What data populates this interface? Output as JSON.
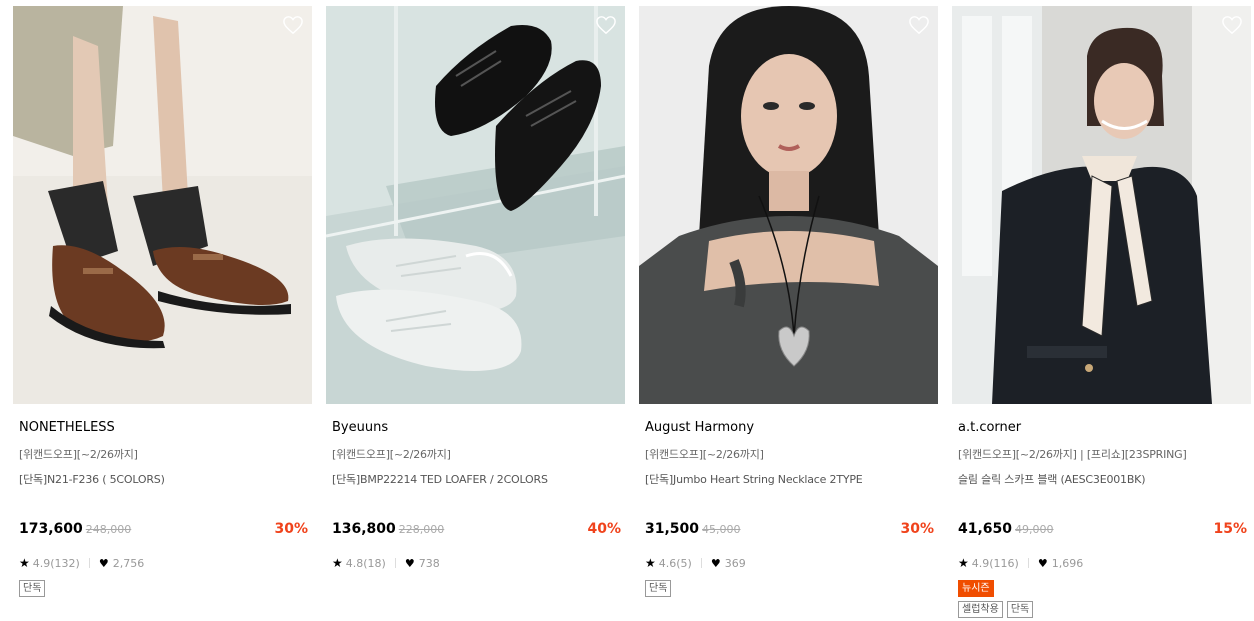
{
  "products": [
    {
      "brand": "NONETHELESS",
      "promo": "[위캔드오프][~2/26까지]",
      "name": "[단독]N21-F236 ( 5COLORS)",
      "price": "173,600",
      "original_price": "248,000",
      "discount": "30%",
      "rating": "4.9(132)",
      "likes": "2,756",
      "tags": [
        "단독"
      ],
      "image_icon": "loafer-shoes-photo"
    },
    {
      "brand": "Byeuuns",
      "promo": "[위캔드오프][~2/26까지]",
      "name": "[단독]BMP22214 TED LOAFER / 2COLORS",
      "price": "136,800",
      "original_price": "228,000",
      "discount": "40%",
      "rating": "4.8(18)",
      "likes": "738",
      "tags": [],
      "image_icon": "derby-shoes-photo"
    },
    {
      "brand": "August Harmony",
      "promo": "[위캔드오프][~2/26까지]",
      "name": "[단독]Jumbo Heart String Necklace 2TYPE",
      "price": "31,500",
      "original_price": "45,000",
      "discount": "30%",
      "rating": "4.6(5)",
      "likes": "369",
      "tags": [
        "단독"
      ],
      "image_icon": "heart-necklace-model-photo"
    },
    {
      "brand": "a.t.corner",
      "promo": "[위캔드오프][~2/26까지] | [프리쇼][23SPRING]",
      "name": "슬림 슬릭 스카프 블랙 (AESC3E001BK)",
      "price": "41,650",
      "original_price": "49,000",
      "discount": "15%",
      "rating": "4.9(116)",
      "likes": "1,696",
      "new_tag": "뉴시즌",
      "tags": [
        "셀럽착용",
        "단독"
      ],
      "image_icon": "scarf-model-photo"
    }
  ],
  "icons": {
    "wishlist": "heart-outline-icon",
    "rating": "star-icon",
    "likes": "heart-filled-icon"
  },
  "colors": {
    "discount": "#f0431c",
    "new_badge": "#f04d00"
  }
}
